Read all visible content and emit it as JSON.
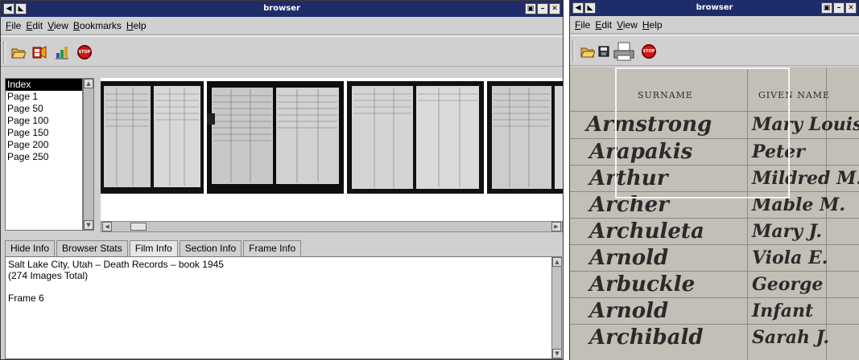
{
  "left_window": {
    "title": "browser",
    "menu": [
      "File",
      "Edit",
      "View",
      "Bookmarks",
      "Help"
    ],
    "toolbar_icons": [
      "open-folder-icon",
      "film-reel-icon",
      "chart-icon",
      "stop-icon"
    ],
    "stop_label": "STOP",
    "index_list": [
      "Index",
      "Page 1",
      "Page 50",
      "Page 100",
      "Page 150",
      "Page 200",
      "Page 250"
    ],
    "tabs": [
      "Hide Info",
      "Browser Stats",
      "Film Info",
      "Section Info",
      "Frame Info"
    ],
    "info": {
      "line1": "Salt Lake City, Utah – Death Records – book 1945",
      "line2": "(274 Images Total)",
      "line3": "Frame 6"
    }
  },
  "right_window": {
    "title": "browser",
    "menu": [
      "File",
      "Edit",
      "View",
      "Help"
    ],
    "toolbar_icons": [
      "open-folder-icon",
      "save-disk-icon",
      "printer-icon",
      "stop-icon"
    ],
    "stop_label": "STOP",
    "headers": [
      "SURNAME",
      "GIVEN NAME"
    ],
    "records": [
      {
        "surname": "Armstrong",
        "given": "Mary Louis"
      },
      {
        "surname": "Arapakis",
        "given": "Peter"
      },
      {
        "surname": "Arthur",
        "given": "Mildred M."
      },
      {
        "surname": "Archer",
        "given": "Mable M."
      },
      {
        "surname": "Archuleta",
        "given": "Mary J."
      },
      {
        "surname": "Arnold",
        "given": "Viola E."
      },
      {
        "surname": "Arbuckle",
        "given": "George"
      },
      {
        "surname": "Arnold",
        "given": "Infant"
      },
      {
        "surname": "Archibald",
        "given": "Sarah J."
      }
    ]
  }
}
